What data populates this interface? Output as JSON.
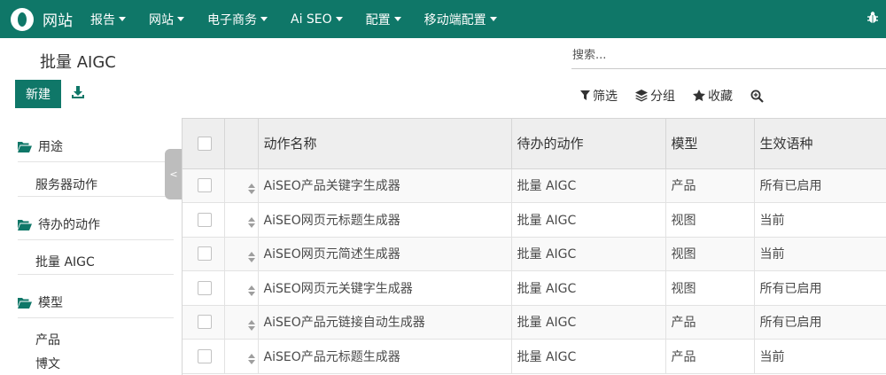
{
  "navbar": {
    "app_title": "网站",
    "menus": [
      {
        "label": "报告"
      },
      {
        "label": "网站"
      },
      {
        "label": "电子商务"
      },
      {
        "label": "Ai SEO"
      },
      {
        "label": "配置"
      },
      {
        "label": "移动端配置"
      }
    ]
  },
  "control": {
    "breadcrumb": "批量 AIGC",
    "search_placeholder": "搜索...",
    "new_label": "新建",
    "filters_label": "筛选",
    "group_label": "分组",
    "favorites_label": "收藏"
  },
  "side": {
    "groups": [
      {
        "header": "用途",
        "items": [
          "服务器动作"
        ]
      },
      {
        "header": "待办的动作",
        "items": [
          "批量 AIGC"
        ]
      },
      {
        "header": "模型",
        "items": [
          "产品",
          "博文"
        ]
      }
    ],
    "collapse_glyph": "<"
  },
  "table": {
    "columns": [
      "动作名称",
      "待办的动作",
      "模型",
      "生效语种"
    ],
    "rows": [
      [
        "AiSEO产品关键字生成器",
        "批量 AIGC",
        "产品",
        "所有已启用"
      ],
      [
        "AiSEO网页元标题生成器",
        "批量 AIGC",
        "视图",
        "当前"
      ],
      [
        "AiSEO网页元简述生成器",
        "批量 AIGC",
        "视图",
        "当前"
      ],
      [
        "AiSEO网页元关键字生成器",
        "批量 AIGC",
        "视图",
        "所有已启用"
      ],
      [
        "AiSEO产品元链接自动生成器",
        "批量 AIGC",
        "产品",
        "所有已启用"
      ],
      [
        "AiSEO产品元标题生成器",
        "批量 AIGC",
        "产品",
        "当前"
      ]
    ]
  },
  "colors": {
    "brand": "#0f7768"
  }
}
